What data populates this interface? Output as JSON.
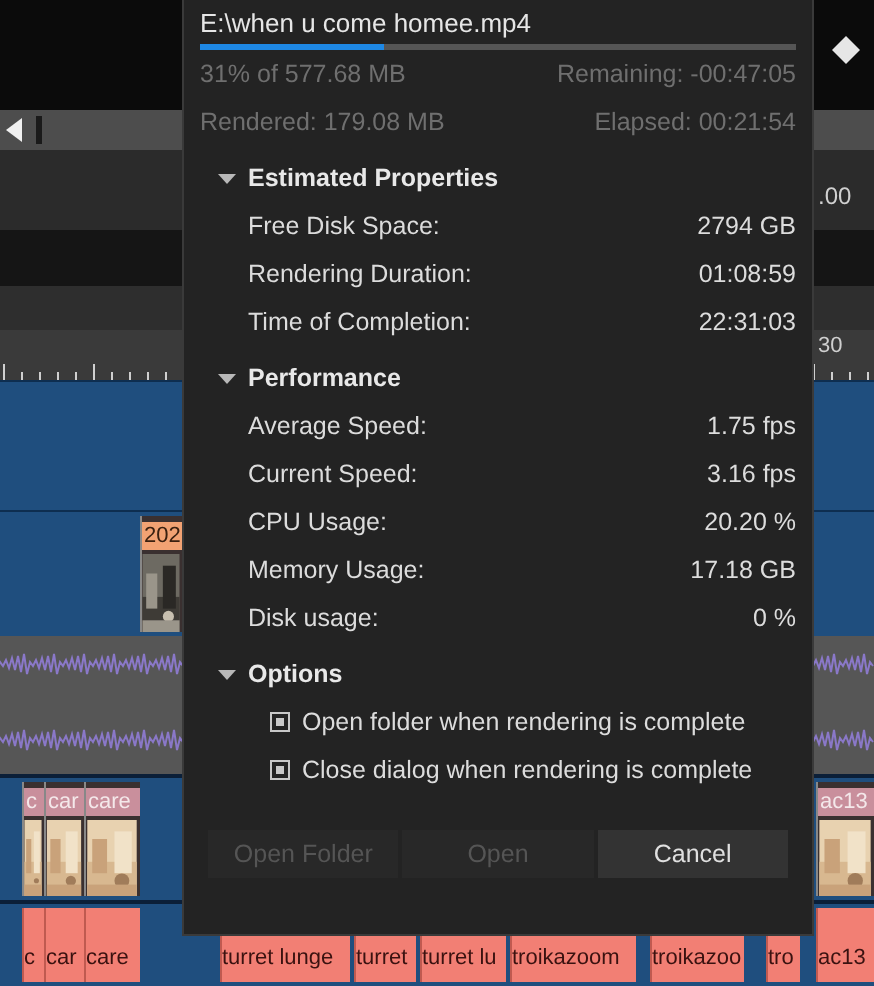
{
  "timeline": {
    "readout": ".00",
    "ruler_label": "30",
    "tracks": [
      {
        "kind": "video",
        "clips": [
          {
            "label": "202"
          }
        ]
      },
      {
        "kind": "video",
        "clips": [
          {
            "label": "c"
          },
          {
            "label": "car"
          },
          {
            "label": "care"
          },
          {
            "label": "ac13"
          }
        ]
      },
      {
        "kind": "strip",
        "clips": [
          {
            "label": "c"
          },
          {
            "label": "car"
          },
          {
            "label": "care"
          },
          {
            "label": "turret lunge"
          },
          {
            "label": "turret"
          },
          {
            "label": "turret lu"
          },
          {
            "label": "troikazoom"
          },
          {
            "label": "troikazoo"
          },
          {
            "label": "tro"
          },
          {
            "label": "ac13"
          }
        ]
      }
    ]
  },
  "dialog": {
    "file_name": "E:\\when u come homee.mp4",
    "progress": {
      "level": 0.31
    },
    "percent_text": "31% of 577.68 MB",
    "remaining": "Remaining: -00:47:05",
    "rendered": "Rendered: 179.08 MB",
    "elapsed": "Elapsed: 00:21:54",
    "sections": [
      {
        "title": "Estimated Properties",
        "expanded": true,
        "kind": "properties",
        "rows": [
          {
            "label": "Free Disk Space:",
            "value": "2794 GB"
          },
          {
            "label": "Rendering Duration:",
            "value": "01:08:59"
          },
          {
            "label": "Time of Completion:",
            "value": "22:31:03"
          }
        ]
      },
      {
        "title": "Performance",
        "expanded": true,
        "kind": "properties",
        "rows": [
          {
            "label": "Average Speed:",
            "value": "1.75 fps"
          },
          {
            "label": "Current Speed:",
            "value": "3.16 fps"
          },
          {
            "label": "CPU Usage:",
            "value": "20.20 %"
          },
          {
            "label": "Memory Usage:",
            "value": "17.18 GB"
          },
          {
            "label": "Disk usage:",
            "value": "0 %"
          }
        ]
      },
      {
        "title": "Options",
        "expanded": true,
        "kind": "options",
        "options": [
          {
            "label": "Open folder when rendering is complete",
            "checked": true
          },
          {
            "label": "Close dialog when rendering is complete",
            "checked": true
          }
        ]
      }
    ],
    "buttons": [
      {
        "label": "Open Folder",
        "disabled": true
      },
      {
        "label": "Open",
        "disabled": true
      },
      {
        "label": "Cancel",
        "disabled": false
      }
    ]
  }
}
